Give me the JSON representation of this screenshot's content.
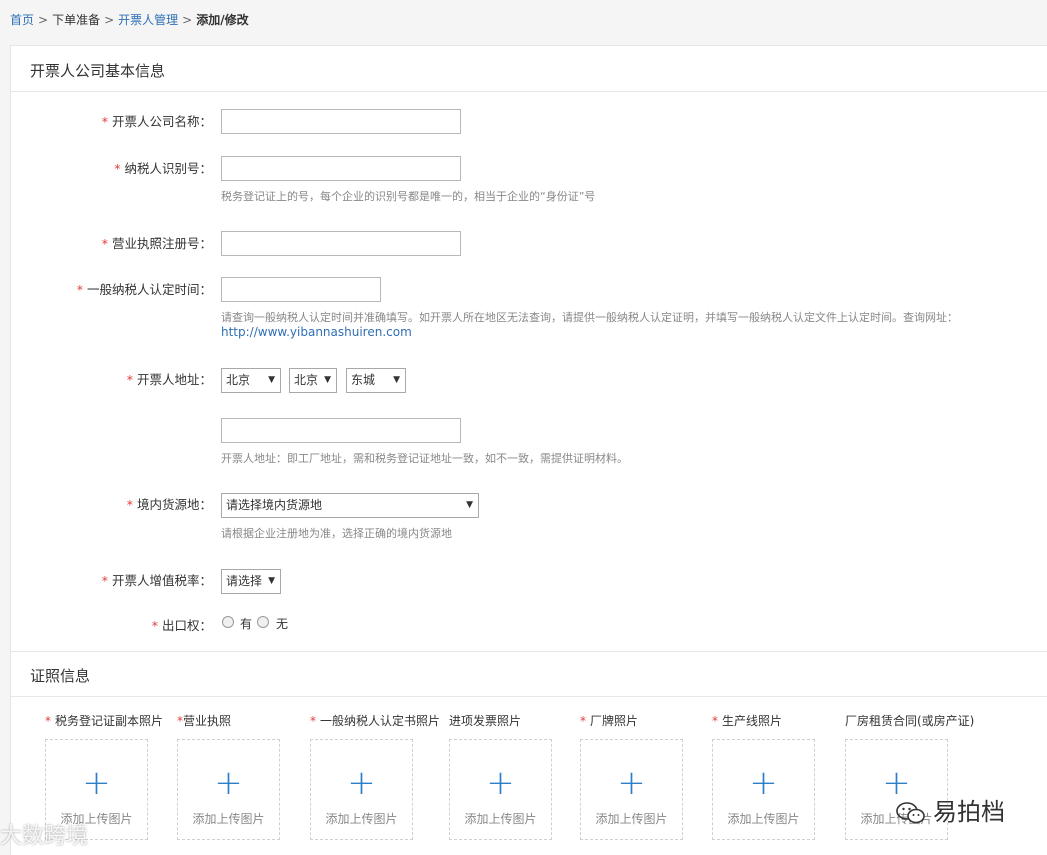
{
  "breadcrumb": {
    "items": [
      "首页",
      "下单准备",
      "开票人管理"
    ],
    "current": "添加/修改"
  },
  "section1": {
    "title": "开票人公司基本信息"
  },
  "fields": {
    "company_name": {
      "label": "开票人公司名称："
    },
    "taxpayer_id": {
      "label": "纳税人识别号：",
      "hint": "税务登记证上的号，每个企业的识别号都是唯一的，相当于企业的“身份证”号"
    },
    "license_no": {
      "label": "营业执照注册号："
    },
    "general_time": {
      "label": "一般纳税人认定时间：",
      "hint": "请查询一般纳税人认定时间并准确填写。如开票人所在地区无法查询，请提供一般纳税人认定证明，并填写一般纳税人认定文件上认定时间。查询网址：",
      "link": "http://www.yibannashuiren.com"
    },
    "address": {
      "label": "开票人地址：",
      "province": "北京",
      "city": "北京",
      "district": "东城",
      "hint": "开票人地址：即工厂地址，需和税务登记证地址一致，如不一致，需提供证明材料。"
    },
    "source": {
      "label": "境内货源地：",
      "value": "请选择境内货源地",
      "hint": "请根据企业注册地为准，选择正确的境内货源地"
    },
    "vat_rate": {
      "label": "开票人增值税率：",
      "value": "请选择"
    },
    "export": {
      "label": "出口权：",
      "yes": "有",
      "no": "无"
    }
  },
  "section2": {
    "title": "证照信息"
  },
  "uploads": [
    {
      "label": "税务登记证副本照片",
      "required": true,
      "text": "添加上传图片"
    },
    {
      "label": "营业执照",
      "required": true,
      "text": "添加上传图片"
    },
    {
      "label": "一般纳税人认定书照片",
      "required": true,
      "text": "添加上传图片"
    },
    {
      "label": "进项发票照片",
      "required": false,
      "text": "添加上传图片"
    },
    {
      "label": "厂牌照片",
      "required": true,
      "text": "添加上传图片"
    },
    {
      "label": "生产线照片",
      "required": true,
      "text": "添加上传图片"
    },
    {
      "label": "厂房租赁合同(或房产证)",
      "required": false,
      "text": "添加上传图片"
    }
  ],
  "required_mark": "*",
  "plus_glyph": "+",
  "caret_glyph": "▼",
  "watermark": {
    "left": "大数跨境",
    "right": "易拍档"
  },
  "colors": {
    "link": "#2f6fb6",
    "required": "#e03c3c",
    "plus": "#2b7fc9"
  }
}
